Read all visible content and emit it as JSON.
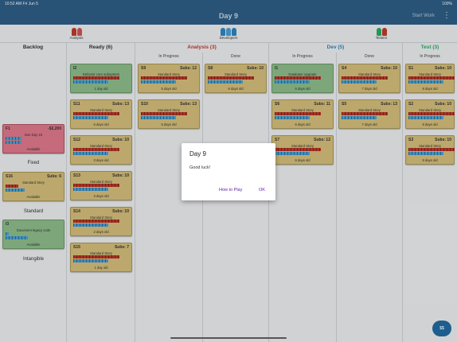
{
  "status": {
    "time": "10:52 AM  Fri Jun 5",
    "battery": "100%"
  },
  "header": {
    "title": "Day 9",
    "start_work": "Start Work",
    "menu": "⋮"
  },
  "teams": [
    {
      "label": "Analysts",
      "color": "#c0392b"
    },
    {
      "label": "Developers",
      "color": "#2e86c1"
    },
    {
      "label": "Testers",
      "color": "#27ae60"
    }
  ],
  "columns": {
    "backlog": "Backlog",
    "ready": "Ready (6)",
    "analysis": "Analysis (3)",
    "dev": "Dev (5)",
    "test": "Test (3)",
    "in_progress": "In Progress",
    "done": "Done"
  },
  "colors": {
    "analysis": "#c0392b",
    "dev": "#2e86c1",
    "test": "#27ae60"
  },
  "backlog": {
    "f1": {
      "id": "F1",
      "subs": "-$2,200",
      "kind": "Due Day 16",
      "age": "Available"
    },
    "fixed": "Fixed",
    "s16": {
      "id": "S16",
      "subs": "Subs: 6",
      "kind": "Standard Story",
      "age": "Available"
    },
    "standard": "Standard",
    "i3": {
      "id": "I3",
      "subs": "",
      "kind": "Document legacy code",
      "age": "Available"
    },
    "intangible": "Intangible"
  },
  "ready": [
    {
      "id": "I2",
      "subs": "",
      "kind": "Refactor core subsystem",
      "age": "1 day old"
    },
    {
      "id": "S11",
      "subs": "Subs: 13",
      "kind": "Standard Story",
      "age": "6 days old"
    },
    {
      "id": "S12",
      "subs": "Subs: 10",
      "kind": "Standard Story",
      "age": "3 days old"
    },
    {
      "id": "S13",
      "subs": "Subs: 10",
      "kind": "Standard Story",
      "age": "3 days old"
    },
    {
      "id": "S14",
      "subs": "Subs: 10",
      "kind": "Standard Story",
      "age": "2 days old"
    },
    {
      "id": "S15",
      "subs": "Subs: 7",
      "kind": "Standard Story",
      "age": "1 day old"
    }
  ],
  "analysis_ip": [
    {
      "id": "S9",
      "subs": "Subs: 12",
      "kind": "Standard Story",
      "age": "5 days old"
    },
    {
      "id": "S10",
      "subs": "Subs: 13",
      "kind": "Standard Story",
      "age": "5 days old"
    }
  ],
  "analysis_done": [
    {
      "id": "S8",
      "subs": "Subs: 10",
      "kind": "Standard Story",
      "age": "6 days old"
    }
  ],
  "dev_ip": [
    {
      "id": "I1",
      "subs": "",
      "kind": "Database Upgrade",
      "age": "6 days old"
    },
    {
      "id": "S6",
      "subs": "Subs: 11",
      "kind": "Standard Story",
      "age": "6 days old"
    },
    {
      "id": "S7",
      "subs": "Subs: 12",
      "kind": "Standard Story",
      "age": "6 days old"
    }
  ],
  "dev_done": [
    {
      "id": "S4",
      "subs": "Subs: 10",
      "kind": "Standard Story",
      "age": "7 days old"
    },
    {
      "id": "S5",
      "subs": "Subs: 13",
      "kind": "Standard Story",
      "age": "7 days old"
    }
  ],
  "test_ip": [
    {
      "id": "S1",
      "subs": "Subs: 10",
      "kind": "Standard Story",
      "age": "8 days old"
    },
    {
      "id": "S2",
      "subs": "Subs: 10",
      "kind": "Standard Story",
      "age": "8 days old"
    },
    {
      "id": "S3",
      "subs": "Subs: 10",
      "kind": "Standard Story",
      "age": "8 days old"
    }
  ],
  "dialog": {
    "title": "Day 9",
    "message": "Good luck!",
    "how_to_play": "How to Play",
    "ok": "OK"
  },
  "fab": {
    "label": "$$"
  }
}
